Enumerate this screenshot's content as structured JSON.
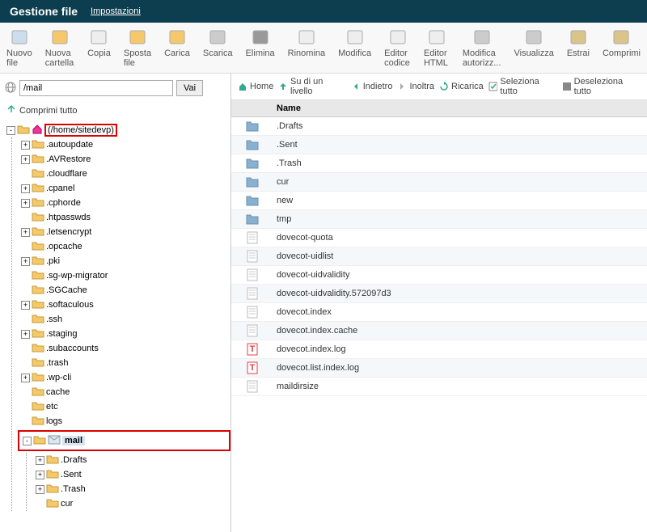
{
  "header": {
    "title": "Gestione file",
    "settings": "Impostazioni"
  },
  "toolbar": [
    {
      "label": "Nuovo file",
      "name": "new-file"
    },
    {
      "label": "Nuova cartella",
      "name": "new-folder"
    },
    {
      "label": "Copia",
      "name": "copy"
    },
    {
      "label": "Sposta file",
      "name": "move"
    },
    {
      "label": "Carica",
      "name": "upload"
    },
    {
      "label": "Scarica",
      "name": "download"
    },
    {
      "label": "Elimina",
      "name": "delete"
    },
    {
      "label": "Rinomina",
      "name": "rename"
    },
    {
      "label": "Modifica",
      "name": "edit"
    },
    {
      "label": "Editor codice",
      "name": "code-editor"
    },
    {
      "label": "Editor HTML",
      "name": "html-editor"
    },
    {
      "label": "Modifica autorizz...",
      "name": "permissions"
    },
    {
      "label": "Visualizza",
      "name": "view"
    },
    {
      "label": "Estrai",
      "name": "extract"
    },
    {
      "label": "Comprimi",
      "name": "compress"
    }
  ],
  "path": {
    "value": "/mail",
    "go": "Vai"
  },
  "collapse_all": "Comprimi tutto",
  "tree": {
    "root": "(/home/sitedevp)",
    "items": [
      {
        "label": ".autoupdate",
        "exp": true
      },
      {
        "label": ".AVRestore",
        "exp": true
      },
      {
        "label": ".cloudflare",
        "exp": false
      },
      {
        "label": ".cpanel",
        "exp": true
      },
      {
        "label": ".cphorde",
        "exp": true
      },
      {
        "label": ".htpasswds",
        "exp": false
      },
      {
        "label": ".letsencrypt",
        "exp": true
      },
      {
        "label": ".opcache",
        "exp": false
      },
      {
        "label": ".pki",
        "exp": true
      },
      {
        "label": ".sg-wp-migrator",
        "exp": false
      },
      {
        "label": ".SGCache",
        "exp": false
      },
      {
        "label": ".softaculous",
        "exp": true
      },
      {
        "label": ".ssh",
        "exp": false
      },
      {
        "label": ".staging",
        "exp": true
      },
      {
        "label": ".subaccounts",
        "exp": false
      },
      {
        "label": ".trash",
        "exp": false
      },
      {
        "label": ".wp-cli",
        "exp": true
      },
      {
        "label": "cache",
        "exp": false
      },
      {
        "label": "etc",
        "exp": false
      },
      {
        "label": "logs",
        "exp": false
      }
    ],
    "mail": {
      "label": "mail",
      "children": [
        {
          "label": ".Drafts",
          "exp": true
        },
        {
          "label": ".Sent",
          "exp": true
        },
        {
          "label": ".Trash",
          "exp": true
        },
        {
          "label": "cur",
          "exp": false
        }
      ]
    }
  },
  "nav": {
    "home": "Home",
    "up": "Su di un livello",
    "back": "Indietro",
    "forward": "Inoltra",
    "reload": "Ricarica",
    "selall": "Seleziona tutto",
    "unsel": "Deseleziona tutto"
  },
  "filelist": {
    "header": "Name",
    "rows": [
      {
        "name": ".Drafts",
        "type": "folder"
      },
      {
        "name": ".Sent",
        "type": "folder"
      },
      {
        "name": ".Trash",
        "type": "folder"
      },
      {
        "name": "cur",
        "type": "folder"
      },
      {
        "name": "new",
        "type": "folder"
      },
      {
        "name": "tmp",
        "type": "folder"
      },
      {
        "name": "dovecot-quota",
        "type": "file"
      },
      {
        "name": "dovecot-uidlist",
        "type": "file"
      },
      {
        "name": "dovecot-uidvalidity",
        "type": "file"
      },
      {
        "name": "dovecot-uidvalidity.572097d3",
        "type": "file"
      },
      {
        "name": "dovecot.index",
        "type": "file"
      },
      {
        "name": "dovecot.index.cache",
        "type": "file"
      },
      {
        "name": "dovecot.index.log",
        "type": "tfile"
      },
      {
        "name": "dovecot.list.index.log",
        "type": "tfile"
      },
      {
        "name": "maildirsize",
        "type": "file"
      }
    ]
  }
}
